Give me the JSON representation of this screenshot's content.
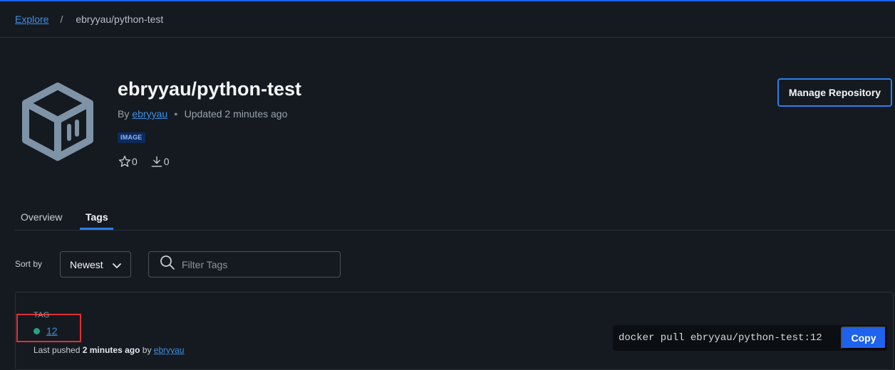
{
  "breadcrumb": {
    "explore": "Explore",
    "separator": "/",
    "current": "ebryyau/python-test"
  },
  "repo": {
    "title": "ebryyau/python-test",
    "by_label": "By",
    "author": "ebryyau",
    "updated": "Updated 2 minutes ago",
    "badge": "IMAGE",
    "stars": "0",
    "pulls": "0",
    "manage_button": "Manage Repository"
  },
  "tabs": [
    {
      "label": "Overview",
      "active": false
    },
    {
      "label": "Tags",
      "active": true
    }
  ],
  "controls": {
    "sort_label": "Sort by",
    "sort_value": "Newest",
    "filter_placeholder": "Filter Tags"
  },
  "tag_list": {
    "header": "TAG",
    "rows": [
      {
        "name": "12",
        "status_color": "#2aa17f",
        "last_pushed_label": "Last pushed",
        "last_pushed_time": "2 minutes ago",
        "by_label": "by",
        "pushed_by": "ebryyau",
        "pull_command": "docker pull ebryyau/python-test:12",
        "copy_label": "Copy"
      }
    ]
  },
  "colors": {
    "accent": "#1d63ed",
    "link": "#3e8fe0",
    "background": "#151a21",
    "highlight": "#e03030"
  },
  "icons": [
    "cube-icon",
    "star-icon",
    "download-icon",
    "chevron-down-icon",
    "search-icon"
  ]
}
